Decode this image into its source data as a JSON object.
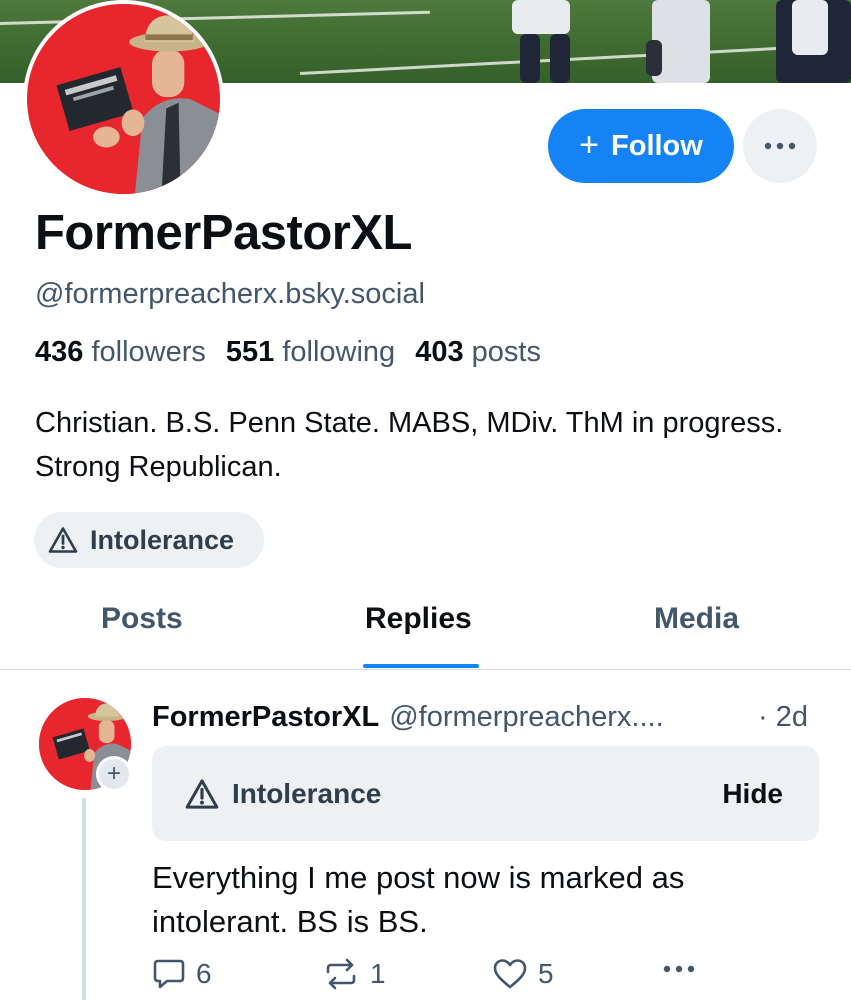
{
  "profile": {
    "display_name": "FormerPastorXL",
    "handle": "@formerpreacherx.bsky.social",
    "followers_count": "436",
    "followers_label": "followers",
    "following_count": "551",
    "following_label": "following",
    "posts_count": "403",
    "posts_label": "posts",
    "bio": "Christian. B.S. Penn State. MABS, MDiv. ThM in progress. Strong Republican.",
    "label": "Intolerance"
  },
  "actions": {
    "follow_label": "Follow"
  },
  "tabs": [
    {
      "label": "Posts",
      "active": false
    },
    {
      "label": "Replies",
      "active": true
    },
    {
      "label": "Media",
      "active": false
    }
  ],
  "post": {
    "author_name": "FormerPastorXL",
    "author_handle": "@formerpreacherx....",
    "time": "· 2d",
    "warning_label": "Intolerance",
    "hide_label": "Hide",
    "text": "Everything I me post now is marked as intolerant. BS is BS.",
    "reply_count": "6",
    "repost_count": "1",
    "like_count": "5"
  },
  "icons": {
    "follow": "plus-icon",
    "more": "ellipsis-icon",
    "label": "warning-triangle-icon",
    "reply": "speech-bubble-icon",
    "repost": "repost-arrows-icon",
    "like": "heart-icon"
  },
  "colors": {
    "accent": "#1583f5",
    "avatar_background": "#e8262d",
    "muted_text": "#42576c",
    "chip_background": "#eef1f4"
  }
}
